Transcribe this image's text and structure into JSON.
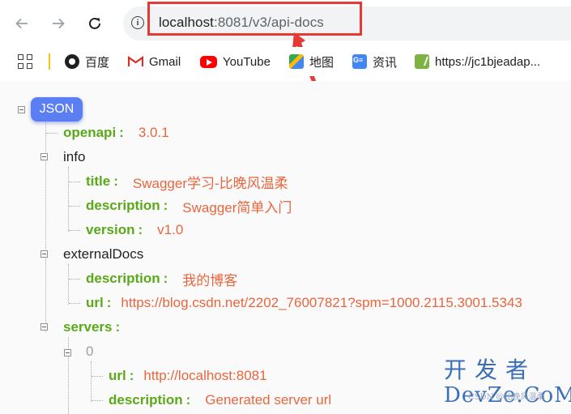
{
  "browser": {
    "url_host": "localhost",
    "url_rest": ":8081/v3/api-docs"
  },
  "bookmarks": [
    {
      "label": "百度"
    },
    {
      "label": "Gmail"
    },
    {
      "label": "YouTube"
    },
    {
      "label": "地图"
    },
    {
      "label": "资讯"
    },
    {
      "label": "https://jc1bjeadap..."
    }
  ],
  "json_viewer": {
    "root_label": "JSON",
    "openapi": {
      "key": "openapi",
      "value": "3.0.1"
    },
    "info": {
      "key": "info",
      "title": {
        "key": "title",
        "value": "Swagger学习-比晚风温柔"
      },
      "description": {
        "key": "description",
        "value": "Swagger简单入门"
      },
      "version": {
        "key": "version",
        "value": "v1.0"
      }
    },
    "externalDocs": {
      "key": "externalDocs",
      "description": {
        "key": "description",
        "value": "我的博客"
      },
      "url": {
        "key": "url",
        "value": "https://blog.csdn.net/2202_76007821?spm=1000.2115.3001.5343"
      }
    },
    "servers": {
      "key": "servers",
      "index": "0",
      "url": {
        "key": "url",
        "value": "http://localhost:8081"
      },
      "description": {
        "key": "description",
        "value": "Generated server url"
      }
    }
  },
  "watermark": {
    "line1": "开发者",
    "line2": "DevZe.CoM",
    "small": "CSDN @比晚风温柔"
  }
}
